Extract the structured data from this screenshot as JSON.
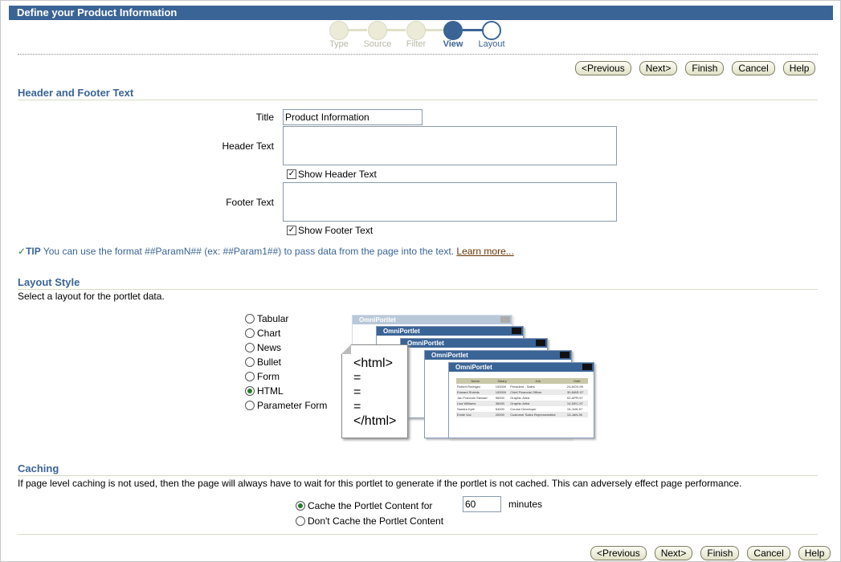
{
  "page": {
    "title": "Define your Product Information"
  },
  "train": {
    "steps": [
      {
        "label": "Type",
        "state": "visited"
      },
      {
        "label": "Source",
        "state": "visited"
      },
      {
        "label": "Filter",
        "state": "visited"
      },
      {
        "label": "View",
        "state": "current"
      },
      {
        "label": "Layout",
        "state": "next"
      }
    ]
  },
  "nav": {
    "previous": "<Previous",
    "next": "Next>",
    "finish": "Finish",
    "cancel": "Cancel",
    "help": "Help"
  },
  "header_footer": {
    "section_title": "Header and Footer Text",
    "title_label": "Title",
    "title_value": "Product Information",
    "header_label": "Header Text",
    "header_value": "",
    "show_header_label": "Show Header Text",
    "show_header_checked": true,
    "footer_label": "Footer Text",
    "footer_value": "",
    "show_footer_label": "Show Footer Text",
    "show_footer_checked": true
  },
  "tip": {
    "icon": "check-icon",
    "word": "TIP",
    "text": "You can use the format ##ParamN## (ex: ##Param1##) to pass data from the page into the text.",
    "link": "Learn more..."
  },
  "layout_style": {
    "section_title": "Layout Style",
    "description": "Select a layout for the portlet data.",
    "options": [
      "Tabular",
      "Chart",
      "News",
      "Bullet",
      "Form",
      "HTML",
      "Parameter Form"
    ],
    "selected": "HTML",
    "preview": {
      "window_title": "OmniPortlet",
      "doc_lines": [
        "<html>",
        "=",
        "=",
        "=",
        "</html>"
      ],
      "table_headers": [
        "Name",
        "Salary",
        "Job",
        "Date"
      ],
      "table_rows": [
        [
          "Robert Rodrigez",
          "100000",
          "President - Sales",
          "24-NOV-95"
        ],
        [
          "Edward Shields",
          "100000",
          "Chief Financial Officer",
          "30-MAR-97"
        ],
        [
          "Jan Francois Stewart",
          "96000",
          "Graphic Artist",
          "02-APR-97"
        ],
        [
          "Lisa Williams",
          "36000",
          "Graphic Artist",
          "14-DEC-97"
        ],
        [
          "Sandra Kyle",
          "54000",
          "Course Developer",
          "15-JUN-97"
        ],
        [
          "Emile Voz",
          "20000",
          "Customer Sales Representative",
          "13-JAN-90"
        ]
      ]
    }
  },
  "caching": {
    "section_title": "Caching",
    "description": "If page level caching is not used, then the page will always have to wait for this portlet to generate if the portlet is not cached. This can adversely effect page performance.",
    "cache_label": "Cache the Portlet Content for",
    "cache_minutes": "60",
    "minutes_label": "minutes",
    "no_cache_label": "Don't Cache the Portlet Content",
    "selected": "cache"
  },
  "colors": {
    "brand": "#3a6495",
    "accent_line": "#d7dcc4"
  }
}
